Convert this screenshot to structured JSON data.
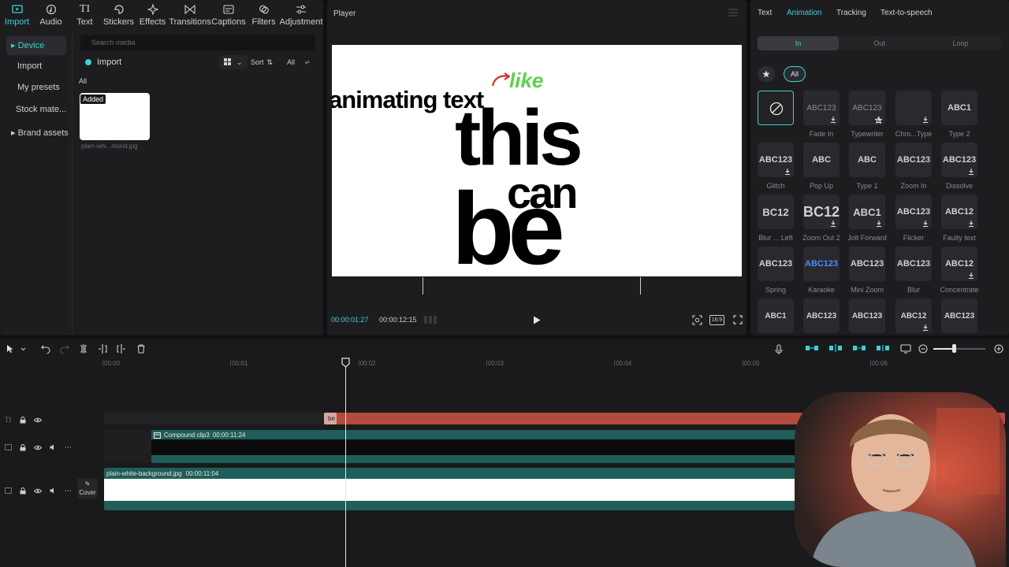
{
  "toolbar": [
    {
      "label": "Import",
      "icon": "import-icon",
      "active": true
    },
    {
      "label": "Audio",
      "icon": "audio-icon"
    },
    {
      "label": "Text",
      "icon": "text-icon"
    },
    {
      "label": "Stickers",
      "icon": "stickers-icon"
    },
    {
      "label": "Effects",
      "icon": "effects-icon"
    },
    {
      "label": "Transitions",
      "icon": "transitions-icon"
    },
    {
      "label": "Captions",
      "icon": "captions-icon"
    },
    {
      "label": "Filters",
      "icon": "filters-icon"
    },
    {
      "label": "Adjustment",
      "icon": "adjustment-icon"
    }
  ],
  "sidebar": {
    "items": [
      {
        "label": "Device",
        "active": true
      },
      {
        "label": "Import"
      },
      {
        "label": "My presets"
      },
      {
        "label": "Stock mate..."
      },
      {
        "label": "Brand assets"
      }
    ]
  },
  "media": {
    "search_placeholder": "Search media",
    "import_label": "Import",
    "sort_label": "Sort",
    "filter_all": "All",
    "section_all": "All",
    "thumb_badge": "Added",
    "thumb_name": "plain-whi...round.jpg"
  },
  "player": {
    "title": "Player",
    "current_time": "00:00:01:27",
    "total_time": "00:00:12:15",
    "aspect": "16:9",
    "canvas_words": {
      "line1": "animating text",
      "accent": "like",
      "big1": "this",
      "mid": "can",
      "big2": "be"
    }
  },
  "anim_panel": {
    "tabs": [
      "Text",
      "Animation",
      "Tracking",
      "Text-to-speech"
    ],
    "active_tab": "Animation",
    "segments": [
      "In",
      "Out",
      "Loop"
    ],
    "active_segment": "In",
    "all_pill": "All",
    "presets": [
      {
        "label": "",
        "preview": "none"
      },
      {
        "label": "Fade In",
        "preview": "ABC123"
      },
      {
        "label": "Typewriter",
        "preview": "ABC123"
      },
      {
        "label": "Chro...Type",
        "preview": ""
      },
      {
        "label": "Type 2",
        "preview": "ABC1"
      },
      {
        "label": "Glitch",
        "preview": "ABC123"
      },
      {
        "label": "Pop Up",
        "preview": "ABC"
      },
      {
        "label": "Type 1",
        "preview": "ABC"
      },
      {
        "label": "Zoom In",
        "preview": "ABC123"
      },
      {
        "label": "Dissolve",
        "preview": "ABC123"
      },
      {
        "label": "Blur ... Left",
        "preview": "BC12"
      },
      {
        "label": "Zoom Out 2",
        "preview": "BC12"
      },
      {
        "label": "Jolt Forward",
        "preview": "ABC1"
      },
      {
        "label": "Flicker",
        "preview": "ABC123"
      },
      {
        "label": "Faulty text",
        "preview": "ABC12"
      },
      {
        "label": "Spring",
        "preview": "ABC123"
      },
      {
        "label": "Karaoke",
        "preview": "ABC123"
      },
      {
        "label": "Mini Zoom",
        "preview": "ABC123"
      },
      {
        "label": "Blur",
        "preview": "ABC123"
      },
      {
        "label": "Concentrate",
        "preview": "ABC12"
      },
      {
        "label": "",
        "preview": "ABC1"
      },
      {
        "label": "",
        "preview": "ABC123"
      },
      {
        "label": "",
        "preview": "ABC123"
      },
      {
        "label": "",
        "preview": "ABC12"
      },
      {
        "label": "",
        "preview": "ABC123"
      }
    ]
  },
  "timeline": {
    "ruler": [
      "00:00",
      "00:01",
      "00:02",
      "00:03",
      "00:04",
      "00:05",
      "00:06"
    ],
    "text_clip": "be",
    "compound_clip": "Compound clip3",
    "compound_duration": "00:00:11:24",
    "bg_clip": "plain-white-background.jpg",
    "bg_duration": "00:00:11:04",
    "cover_label": "Cover"
  },
  "colors": {
    "accent": "#3ad1d6",
    "text_clip": "#b54a3e",
    "video_clip": "#1f5e59",
    "like_green": "#5fcf4f",
    "arrow_red": "#d2342c"
  }
}
